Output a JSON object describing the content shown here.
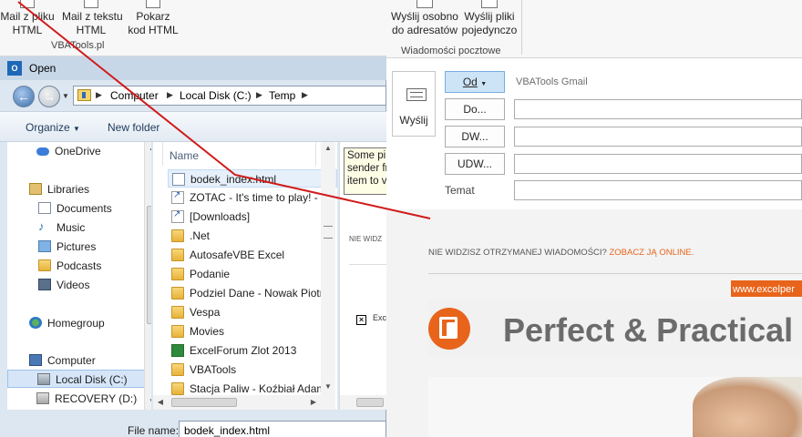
{
  "ribbon_left": {
    "buttons": [
      {
        "line1": "Mail z pliku",
        "line2": "HTML"
      },
      {
        "line1": "Mail z tekstu",
        "line2": "HTML"
      },
      {
        "line1": "Pokarz",
        "line2": "kod HTML"
      }
    ],
    "group_label": "VBATools.pl"
  },
  "open_dialog": {
    "title": "Open",
    "app_icon_label": "O",
    "address": {
      "crumbs": [
        "Computer",
        "Local Disk (C:)",
        "Temp"
      ]
    },
    "toolbar": {
      "organize": "Organize",
      "new_folder": "New folder"
    },
    "nav": {
      "items": [
        {
          "label": "OneDrive",
          "icon": "onedrive-icon"
        },
        {
          "label": "Libraries",
          "icon": "libraries-icon"
        },
        {
          "label": "Documents",
          "icon": "documents-icon"
        },
        {
          "label": "Music",
          "icon": "music-icon"
        },
        {
          "label": "Pictures",
          "icon": "pictures-icon"
        },
        {
          "label": "Podcasts",
          "icon": "folder-icon"
        },
        {
          "label": "Videos",
          "icon": "videos-icon"
        },
        {
          "label": "Homegroup",
          "icon": "homegroup-icon"
        },
        {
          "label": "Computer",
          "icon": "computer-icon"
        },
        {
          "label": "Local Disk (C:)",
          "icon": "drive-icon"
        },
        {
          "label": "RECOVERY (D:)",
          "icon": "drive-icon"
        }
      ]
    },
    "files": {
      "column_name": "Name",
      "rows": [
        {
          "name": "bodek_index.html",
          "icon": "html-file-icon"
        },
        {
          "name": "ZOTAC - It's time to play! - I",
          "icon": "shortcut-icon"
        },
        {
          "name": "[Downloads]",
          "icon": "shortcut-icon"
        },
        {
          "name": ".Net",
          "icon": "folder-icon"
        },
        {
          "name": "AutosafeVBE Excel",
          "icon": "folder-icon"
        },
        {
          "name": "Podanie",
          "icon": "folder-icon"
        },
        {
          "name": "Podziel Dane - Nowak Piotr",
          "icon": "folder-icon"
        },
        {
          "name": "Vespa",
          "icon": "folder-icon"
        },
        {
          "name": "Movies",
          "icon": "folder-icon"
        },
        {
          "name": "ExcelForum Zlot 2013",
          "icon": "excel-folder-icon"
        },
        {
          "name": "VBATools",
          "icon": "folder-icon"
        },
        {
          "name": "Stacja Paliw - Koźbiał Adam",
          "icon": "folder-icon"
        }
      ]
    },
    "preview": {
      "tooltip_lines": [
        "Some pi",
        "sender fr",
        "item to v"
      ],
      "text": "NIE WIDZ",
      "exc_text": "Exc"
    },
    "filename_label": "File name:",
    "filename_value": "bodek_index.html"
  },
  "ribbon_right": {
    "buttons": [
      {
        "line1": "Wyślij osobno",
        "line2": "do adresatów"
      },
      {
        "line1": "Wyślij pliki",
        "line2": "pojedynczo"
      }
    ],
    "group_label": "Wiadomości pocztowe"
  },
  "message": {
    "send_label": "Wyślij",
    "from_label": "Od",
    "from_account": "VBATools Gmail",
    "to_label": "Do...",
    "cc_label": "DW...",
    "bcc_label": "UDW...",
    "subject_label": "Temat"
  },
  "newsletter": {
    "top_text": "NIE WIDZISZ OTRZYMANEJ WIADOMOŚCI?",
    "top_link": "ZOBACZ JĄ ONLINE.",
    "site": "www.excelper",
    "headline": "Perfect & Practical"
  },
  "colors": {
    "accent_orange": "#e8641b",
    "annotation_red": "#d11a1a",
    "from_button_blue": "#cde4f7"
  }
}
